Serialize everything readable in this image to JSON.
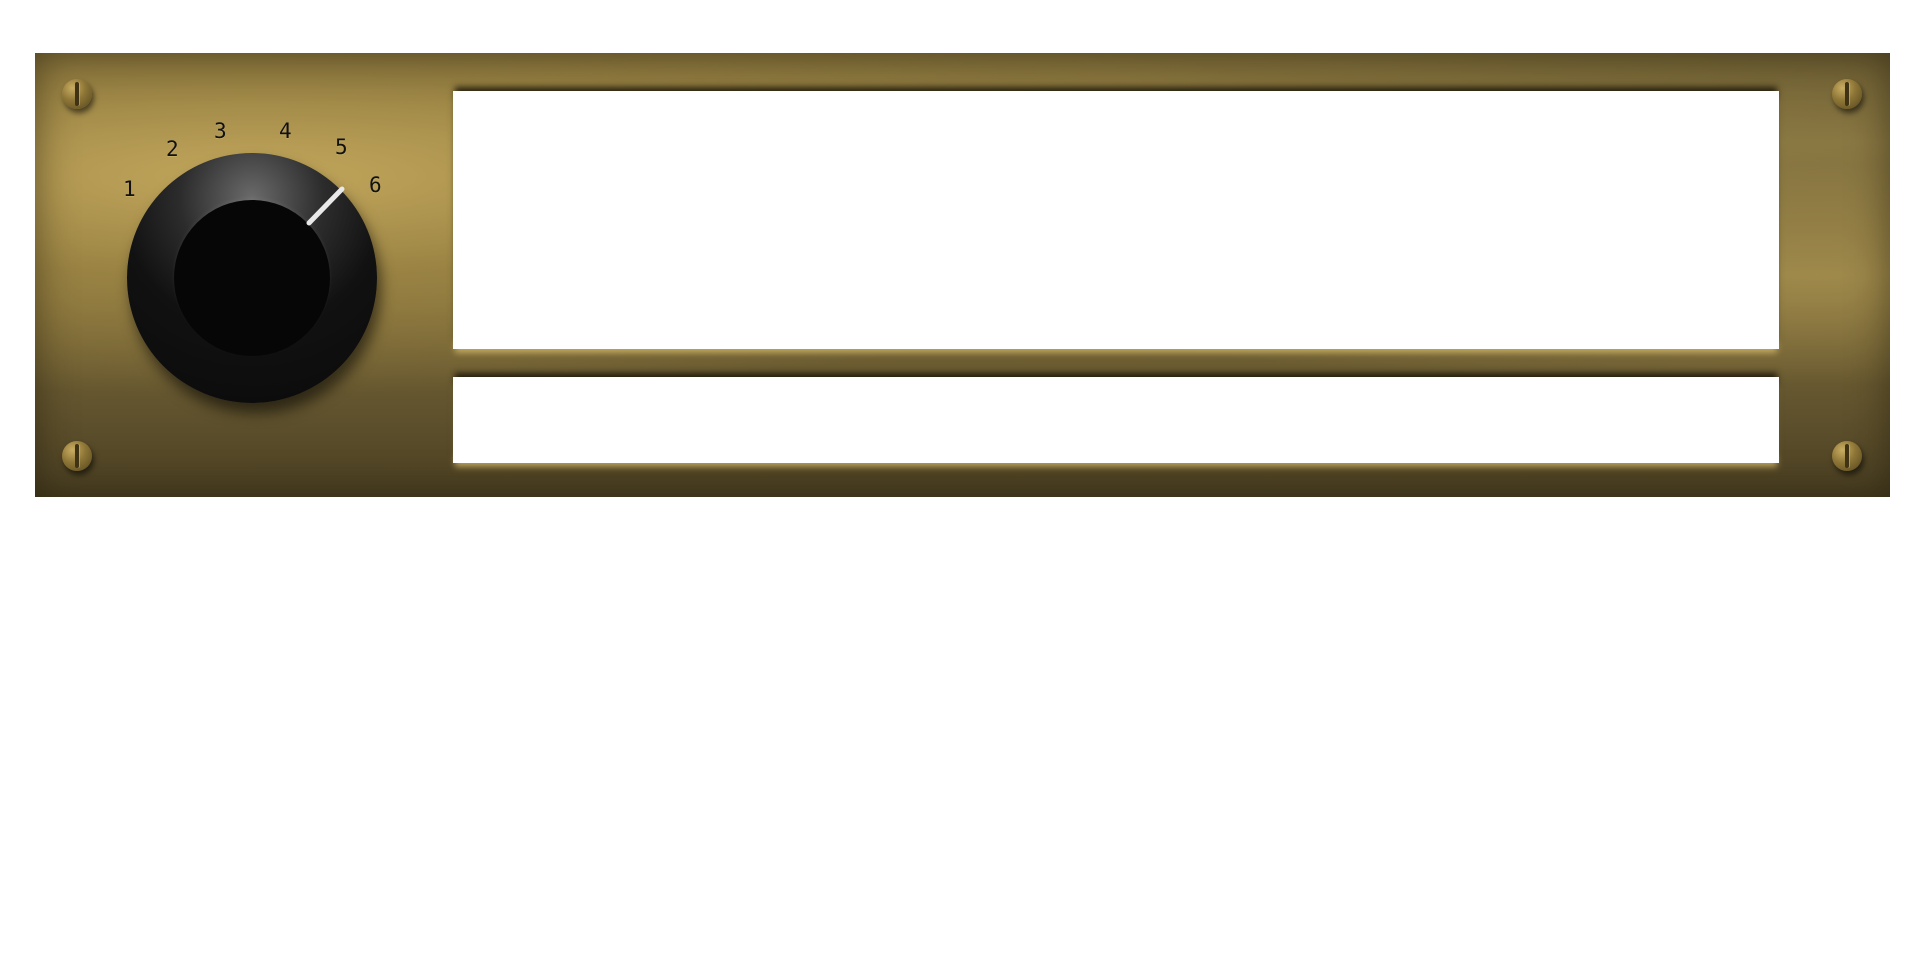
{
  "dial": {
    "labels": [
      "1",
      "2",
      "3",
      "4",
      "5",
      "6"
    ],
    "selected": "6"
  },
  "colors": {
    "panel": "#8a7843",
    "knob": "#0a0a0a",
    "marker": "#e8e8e8",
    "display": "#ffffff"
  }
}
